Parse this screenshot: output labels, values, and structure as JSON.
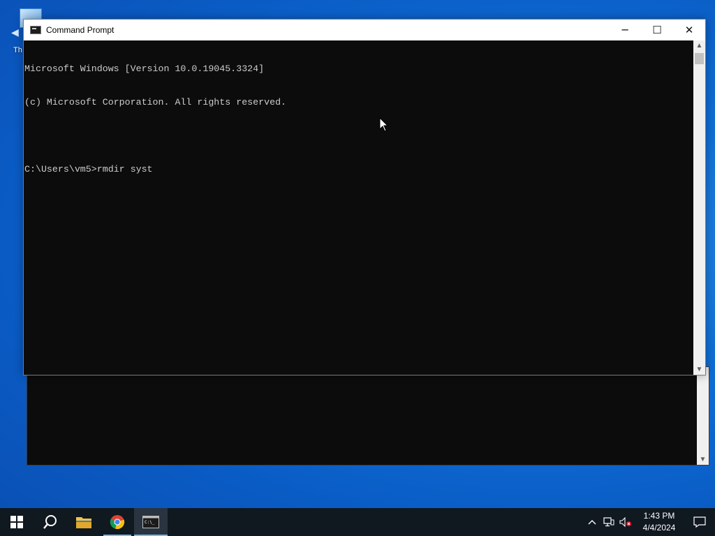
{
  "desktop": {
    "icon_label": "Th"
  },
  "window": {
    "title": "Command Prompt",
    "controls": {
      "minimize": "─",
      "maximize": "☐",
      "close": "✕"
    },
    "console_lines": [
      "Microsoft Windows [Version 10.0.19045.3324]",
      "(c) Microsoft Corporation. All rights reserved.",
      "",
      "C:\\Users\\vm5>rmdir syst"
    ]
  },
  "taskbar": {
    "items": [
      {
        "name": "start-button",
        "icon": "windows-logo-icon"
      },
      {
        "name": "search-button",
        "icon": "search-icon"
      },
      {
        "name": "file-explorer",
        "icon": "folder-icon"
      },
      {
        "name": "chrome",
        "icon": "chrome-icon"
      },
      {
        "name": "command-prompt",
        "icon": "terminal-icon"
      }
    ],
    "clock_time": "1:43 PM",
    "clock_date": "4/4/2024"
  },
  "colors": {
    "console_bg": "#0c0c0c",
    "console_text": "#cccccc",
    "taskbar_bg": "#101820",
    "accent": "#76b9ed"
  }
}
